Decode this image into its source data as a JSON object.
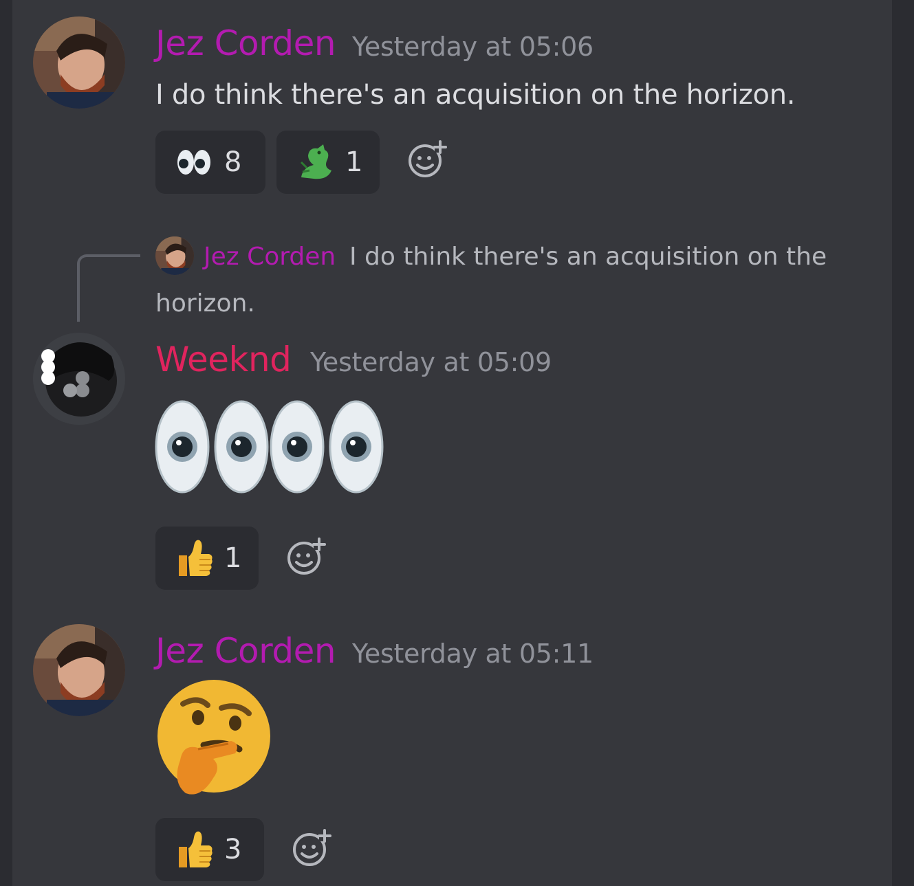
{
  "colors": {
    "jez": "#b31bb0",
    "weeknd": "#e0245e",
    "timestamp": "#90929a",
    "text": "#dcdde1"
  },
  "messages": [
    {
      "author": "Jez Corden",
      "timestamp": "Yesterday at 05:06",
      "text": "I do think there's an acquisition on the horizon.",
      "reactions": [
        {
          "emoji": "eyes",
          "count": "8"
        },
        {
          "emoji": "dragon",
          "count": "1"
        }
      ]
    },
    {
      "reply_to": {
        "author": "Jez Corden",
        "text_line1": "I do think there's an acquisition on the",
        "text_line2": "horizon."
      },
      "author": "Weeknd",
      "timestamp": "Yesterday at 05:09",
      "emoji_content": [
        "eyes",
        "eyes"
      ],
      "reactions": [
        {
          "emoji": "thumbs-up",
          "count": "1"
        }
      ]
    },
    {
      "author": "Jez Corden",
      "timestamp": "Yesterday at 05:11",
      "emoji_content": [
        "thinking-face"
      ],
      "reactions": [
        {
          "emoji": "thumbs-up",
          "count": "3"
        }
      ]
    }
  ]
}
